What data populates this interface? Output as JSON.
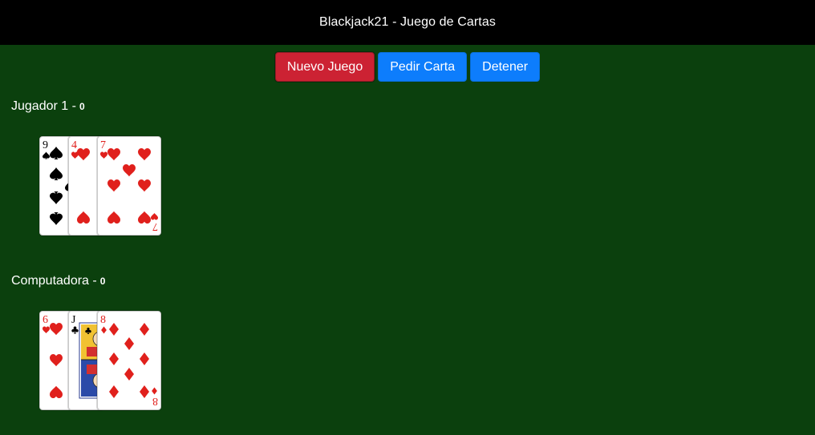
{
  "header": {
    "title": "Blackjack21 - Juego de Cartas"
  },
  "controls": {
    "new_game": "Nuevo Juego",
    "hit": "Pedir Carta",
    "stand": "Detener"
  },
  "colors": {
    "table": "#0b400d",
    "header": "#000000",
    "new_game_button": "#cc2233",
    "action_button": "#0d7dfc",
    "red_suit": "#e0201c",
    "black_suit": "#000000"
  },
  "players": [
    {
      "name": "Jugador 1 -",
      "score": "0",
      "cards": [
        {
          "rank": "9",
          "suit": "spades"
        },
        {
          "rank": "4",
          "suit": "hearts"
        },
        {
          "rank": "7",
          "suit": "hearts"
        }
      ]
    },
    {
      "name": "Computadora -",
      "score": "0",
      "cards": [
        {
          "rank": "6",
          "suit": "hearts"
        },
        {
          "rank": "J",
          "suit": "clubs"
        },
        {
          "rank": "8",
          "suit": "diamonds"
        }
      ]
    }
  ]
}
